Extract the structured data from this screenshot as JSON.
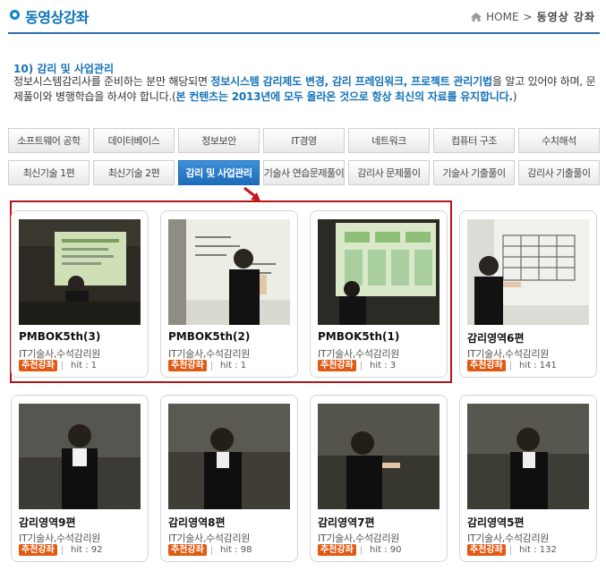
{
  "header": {
    "title": "동영상강좌",
    "breadcrumb_home": "HOME",
    "breadcrumb_sep": ">",
    "breadcrumb_current": "동영상 강좌"
  },
  "section": {
    "title": "10) 감리 및 사업관리",
    "desc_1": "정보시스템감리사를 준비하는 분만 해당되면 ",
    "desc_2": "정보시스템 감리제도 변경, 감리 프레임워크, 프로젝트 관리기법",
    "desc_3": "을 알고 있어야 하며, 문제풀이와 병행학습을 하셔야 합니다.(",
    "desc_4": "본 컨텐츠는 2013년에 모두 올라온 것으로 항상 최신의 자료를 유지합니다.",
    "desc_5": ")"
  },
  "tabs_row1": [
    "소프트웨어 공학",
    "데이터베이스",
    "정보보안",
    "IT경영",
    "네트워크",
    "컴퓨터 구조",
    "수치해석"
  ],
  "tabs_row2": [
    "최신기술 1편",
    "최신기술 2편",
    "감리 및 사업관리",
    "기술사 연습문제풀이",
    "감리사 문제풀이",
    "기술사 기출풀이",
    "감리사 기출풀이"
  ],
  "active_tab": "감리 및 사업관리",
  "videos": [
    {
      "title": "PMBOK5th(3)",
      "author": "IT기술사,수석감리원",
      "badge": "추천강좌",
      "hit": "hit : 1"
    },
    {
      "title": "PMBOK5th(2)",
      "author": "IT기술사,수석감리원",
      "badge": "추천강좌",
      "hit": "hit : 1"
    },
    {
      "title": "PMBOK5th(1)",
      "author": "IT기술사,수석감리원",
      "badge": "추천강좌",
      "hit": "hit : 3"
    },
    {
      "title": "감리영역6편",
      "author": "IT기술사,수석감리원",
      "badge": "추천강좌",
      "hit": "hit : 141"
    },
    {
      "title": "감리영역9편",
      "author": "IT기술사,수석감리원",
      "badge": "추천강좌",
      "hit": "hit : 92"
    },
    {
      "title": "감리영역8편",
      "author": "IT기술사,수석감리원",
      "badge": "추천강좌",
      "hit": "hit : 98"
    },
    {
      "title": "감리영역7편",
      "author": "IT기술사,수석감리원",
      "badge": "추천강좌",
      "hit": "hit : 90"
    },
    {
      "title": "감리영역5편",
      "author": "IT기술사,수석감리원",
      "badge": "추천강좌",
      "hit": "hit : 132"
    }
  ],
  "colors": {
    "accent": "#1673b8",
    "tab_active": "#2a7cc8",
    "badge": "#e05a14",
    "highlight_box": "#b3161b"
  }
}
